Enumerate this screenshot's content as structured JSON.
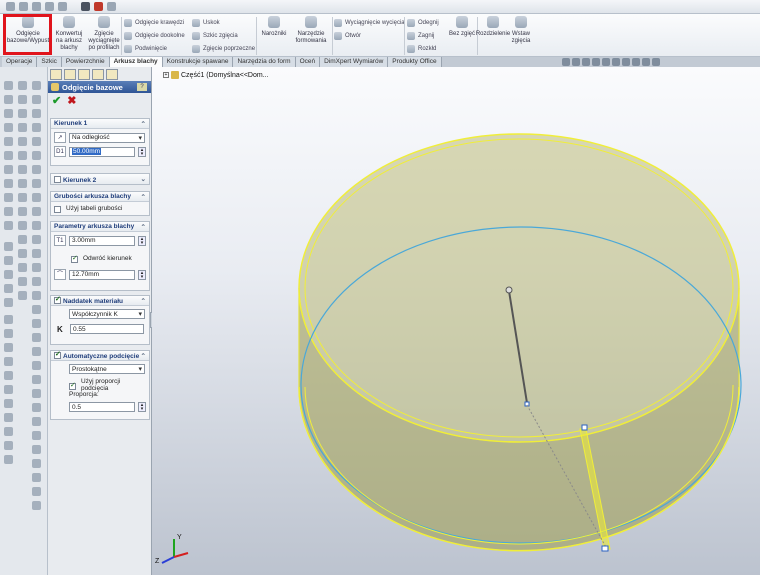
{
  "ribbon": {
    "base_flange": "Odgięcie bazowe/Wypust",
    "convert": "Konwertuj na arkusz blachy",
    "fold_lines": "Zgięcie wyciągnięte po profilach",
    "edge_flange": "Odgięcie krawędzi",
    "miter_flange": "Odgięcie dookolne",
    "hem": "Podwinięcie",
    "jog": "Uskok",
    "sketched_bend": "Szkic zgięcia",
    "cross_break": "Zgięcie poprzeczne",
    "corners": "Narożniki",
    "forming_tool": "Narzędzie formowania",
    "extruded_cut": "Wyciągnięcie wycięcia",
    "vent": "Otwór",
    "unfold": "Odegnij",
    "fold": "Zagnij",
    "flatten": "Rozkłd",
    "no_bends": "Bez zgięć",
    "rip": "Rozdzielenie",
    "insert_bends": "Wstaw zgięcia"
  },
  "tabs": [
    "Operacje",
    "Szkic",
    "Powierzchnie",
    "Arkusz blachy",
    "Konstrukcje spawane",
    "Narzędzia do form",
    "Oceń",
    "DimXpert Wymiarów",
    "Produkty Office"
  ],
  "active_tab": "Arkusz blachy",
  "tree": {
    "root_label": "Część1  (Domyślna<<Dom..."
  },
  "pm": {
    "title": "Odgięcie bazowe",
    "help": "?",
    "ok": "✔",
    "cancel": "✖",
    "dir1": {
      "header": "Kierunek 1",
      "end_condition": "Na odległość",
      "depth_label": "D1",
      "depth": "50.00mm"
    },
    "dir2": {
      "header": "Kierunek 2"
    },
    "gauge": {
      "header": "Grubości arkusza blachy",
      "use_table": "Użyj tabeli grubości"
    },
    "params": {
      "header": "Parametry arkusza blachy",
      "thickness_label": "T1",
      "thickness": "3.00mm",
      "reverse": "Odwróć kierunek",
      "radius": "12.70mm"
    },
    "allowance": {
      "header": "Naddatek materiału",
      "type": "Współczynnik K",
      "k_label": "K",
      "k": "0.55"
    },
    "relief": {
      "header": "Automatyczne podcięcie",
      "type": "Prostokątne",
      "use_ratio": "Użyj proporcji podcięcia",
      "ratio_label": "Proporcja:",
      "ratio": "0.5"
    }
  },
  "colors": {
    "highlight": "#e0141c",
    "pm_title": "#2f5596",
    "part": "#9c9a4a",
    "edge": "#f0ee3a",
    "axis_x": "#d42020",
    "axis_y": "#1ea41e",
    "axis_z": "#2a3ed6"
  },
  "axes": {
    "x": "",
    "y": "Y",
    "z": "Z"
  }
}
